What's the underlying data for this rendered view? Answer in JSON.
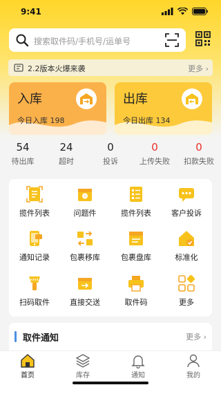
{
  "status_bar": {
    "time": "9:41"
  },
  "search": {
    "placeholder": "搜索取件码/手机号/运单号"
  },
  "notice": {
    "text": "2.2版本火爆来袭",
    "more": "更多"
  },
  "cards": {
    "inbound": {
      "title": "入库",
      "subtitle": "今日入库 198"
    },
    "outbound": {
      "title": "出库",
      "subtitle": "今日出库 134"
    }
  },
  "stats": [
    {
      "value": "54",
      "label": "待出库",
      "highlight": false
    },
    {
      "value": "24",
      "label": "超时",
      "highlight": false
    },
    {
      "value": "0",
      "label": "投诉",
      "highlight": false
    },
    {
      "value": "0",
      "label": "上传失败",
      "highlight": true
    },
    {
      "value": "0",
      "label": "扣款失败",
      "highlight": true
    }
  ],
  "grid": [
    {
      "label": "揽件列表",
      "icon": "parcel-list-icon"
    },
    {
      "label": "问题件",
      "icon": "problem-box-icon"
    },
    {
      "label": "揽件列表",
      "icon": "list-doc-icon"
    },
    {
      "label": "客户投诉",
      "icon": "chat-icon"
    },
    {
      "label": "通知记录",
      "icon": "phone-message-icon"
    },
    {
      "label": "包裹移库",
      "icon": "move-box-icon"
    },
    {
      "label": "包裹盘库",
      "icon": "inventory-box-icon"
    },
    {
      "label": "标准化",
      "icon": "home-check-icon"
    },
    {
      "label": "扫码取件",
      "icon": "scanner-icon"
    },
    {
      "label": "直接交送",
      "icon": "handover-box-icon"
    },
    {
      "label": "取件码",
      "icon": "printer-icon"
    },
    {
      "label": "更多",
      "icon": "more-grid-icon"
    }
  ],
  "pickup_notice": {
    "title": "取件通知",
    "more": "更多"
  },
  "tabs": [
    {
      "label": "首页",
      "icon": "home-icon",
      "active": true
    },
    {
      "label": "库存",
      "icon": "layers-icon",
      "active": false
    },
    {
      "label": "通知",
      "icon": "bell-icon",
      "active": false
    },
    {
      "label": "我的",
      "icon": "user-icon",
      "active": false
    }
  ],
  "colors": {
    "brand": "#ffd629",
    "inbound": "#fbb14a",
    "outbound": "#fcca3b",
    "alert": "#e8302a",
    "icon_yellow": "#f7c21c"
  }
}
